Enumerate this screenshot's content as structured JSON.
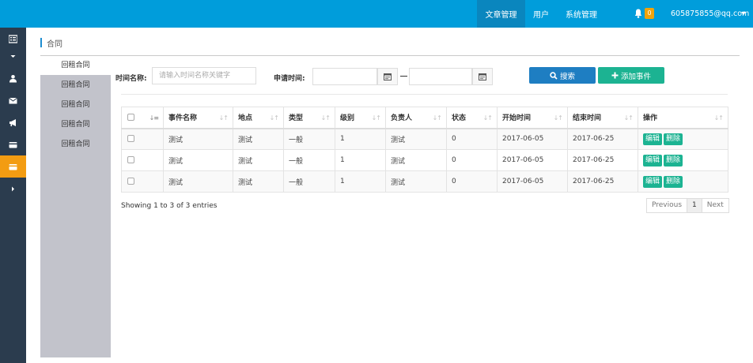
{
  "topbar": {
    "nav": [
      "文章管理",
      "用户",
      "系统管理"
    ],
    "notification_count": "0",
    "user_email": "605875855@qq.com",
    "bg_color": "#009ddb",
    "active_color": "#0a86be"
  },
  "sidebar": {
    "icons": [
      "list-icon",
      "chevron-down-icon",
      "user-icon",
      "envelope-icon",
      "bullhorn-icon",
      "credit-card-icon",
      "credit-card-icon",
      "chevron-right-icon"
    ],
    "active_index": 6,
    "bg_color": "#2b3c4e",
    "active_color": "#f39c12"
  },
  "breadcrumb": {
    "title": "合同"
  },
  "submenu": {
    "items": [
      "回租合同",
      "回租合同",
      "回租合同",
      "回租合同",
      "回租合同"
    ]
  },
  "filter": {
    "name_label": "时间名称:",
    "name_placeholder": "请输入时间名称关键字",
    "date_label": "申请时间:",
    "search_label": "搜索",
    "add_label": "添加事件"
  },
  "table": {
    "headers": [
      "事件名称",
      "地点",
      "类型",
      "级别",
      "负责人",
      "状态",
      "开始时间",
      "结束时间",
      "操作"
    ],
    "rows": [
      [
        "测试",
        "测试",
        "一般",
        "1",
        "测试",
        "0",
        "2017-06-05",
        "2017-06-25"
      ],
      [
        "测试",
        "测试",
        "一般",
        "1",
        "测试",
        "0",
        "2017-06-05",
        "2017-06-25"
      ],
      [
        "测试",
        "测试",
        "一般",
        "1",
        "测试",
        "0",
        "2017-06-05",
        "2017-06-25"
      ]
    ],
    "edit_label": "编辑",
    "delete_label": "删除"
  },
  "footer": {
    "info": "Showing 1 to 3 of 3 entries",
    "prev": "Previous",
    "page": "1",
    "next": "Next"
  }
}
